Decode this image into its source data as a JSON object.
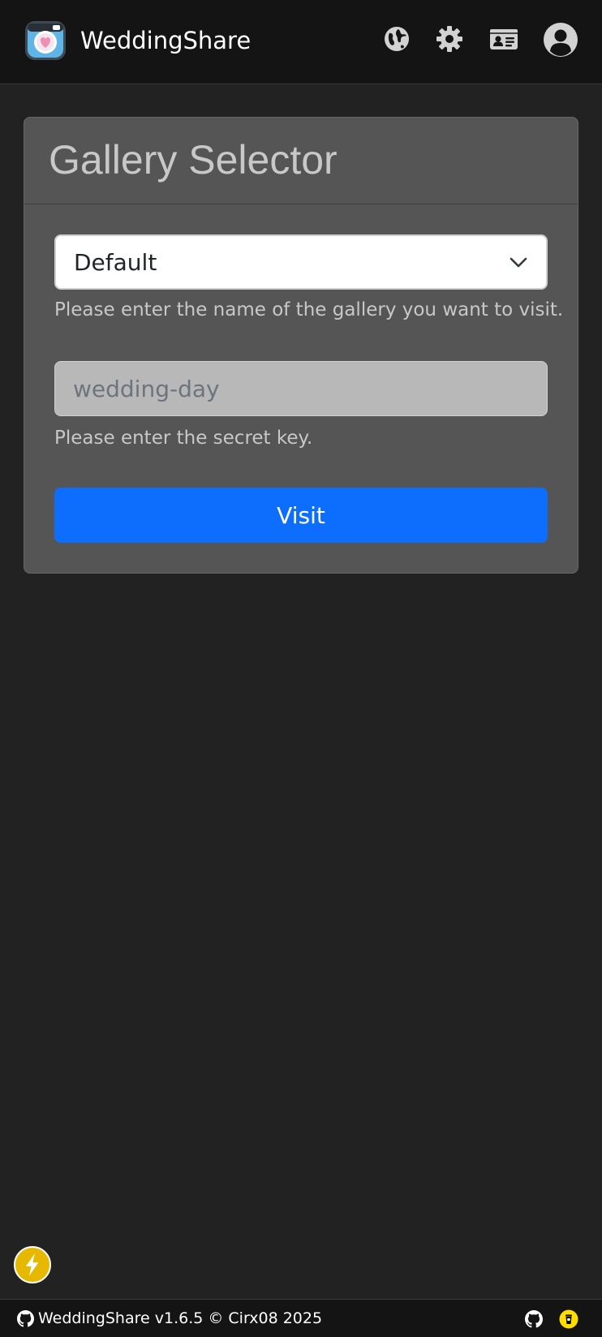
{
  "header": {
    "brand_name": "WeddingShare",
    "icons": [
      "camera-heart-logo-icon",
      "globe-icon",
      "gear-icon",
      "id-card-icon",
      "user-avatar-icon"
    ]
  },
  "gallery_selector": {
    "title": "Gallery Selector",
    "selected_gallery": "Default",
    "gallery_help": "Please enter the name of the gallery you want to visit.",
    "secret_placeholder": "wedding-day",
    "secret_value": "",
    "secret_help": "Please enter the secret key.",
    "visit_label": "Visit"
  },
  "footer": {
    "text": "WeddingShare v1.6.5 © Cirx08 2025",
    "icons": [
      "github-icon",
      "buy-me-a-coffee-icon"
    ]
  },
  "floating": {
    "icon": "lightning-icon"
  },
  "colors": {
    "background": "#222222",
    "navbar": "#141414",
    "card": "#555555",
    "primary": "#0d6efd",
    "accent_yellow": "#e6b800"
  }
}
